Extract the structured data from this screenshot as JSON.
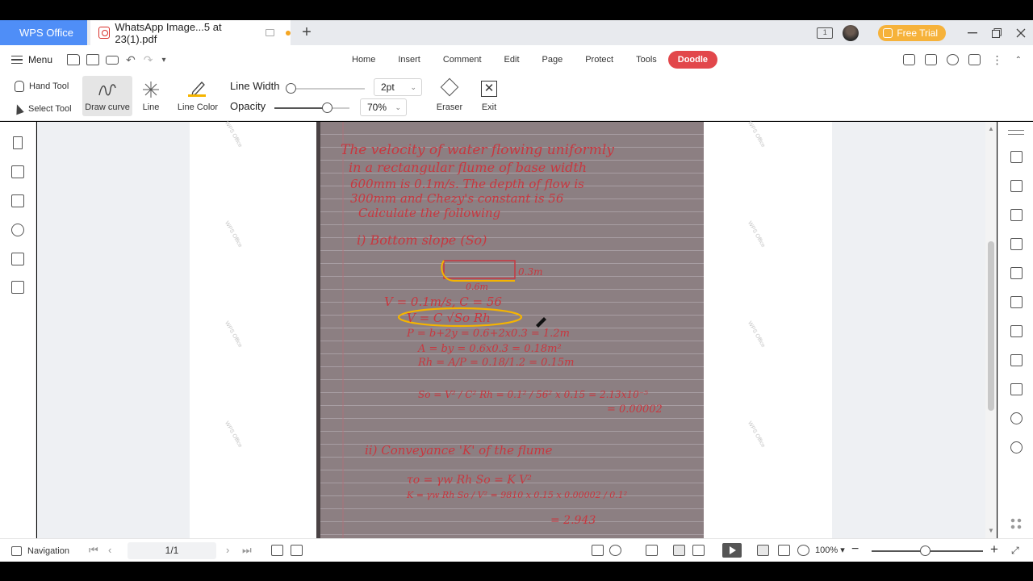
{
  "tabs": {
    "app_label": "WPS Office",
    "doc_label": "WhatsApp Image...5 at 23(1).pdf",
    "add_label": "+"
  },
  "window": {
    "free_trial_label": "Free Trial",
    "page_count_badge": "1"
  },
  "menubar": {
    "menu_label": "Menu",
    "tabs": [
      "Home",
      "Insert",
      "Comment",
      "Edit",
      "Page",
      "Protect",
      "Tools",
      "Doodle"
    ],
    "active_tab": "Doodle"
  },
  "toolbar": {
    "hand_tool": "Hand Tool",
    "select_tool": "Select Tool",
    "draw_curve": "Draw curve",
    "line": "Line",
    "line_color": "Line Color",
    "line_color_value": "#f5b400",
    "line_width_label": "Line Width",
    "line_width_value": "2pt",
    "line_width_level": 0.0,
    "opacity_label": "Opacity",
    "opacity_value": "70%",
    "opacity_level": 0.7,
    "eraser": "Eraser",
    "exit": "Exit"
  },
  "document": {
    "watermark": "WPS Office",
    "handwriting": [
      "The velocity of water flowing uniformly",
      "in a rectangular flume of base width",
      "600mm is 0.1m/s. The depth of flow is",
      "300mm and Chezy's constant is 56",
      "Calculate the following",
      "i) Bottom slope (So)",
      "0.3m",
      "0.6m",
      "V = 0.1m/s, C = 56",
      "V = C √So Rh",
      "P = b+2y = 0.6+2x0.3 = 1.2m",
      "A = by = 0.6x0.3 = 0.18m²",
      "Rh = A/P = 0.18/1.2 = 0.15m",
      "So = V² / C² Rh = 0.1² / 56² x 0.15 = 2.13x10⁻⁵",
      "= 0.00002",
      "ii) Conveyance 'K' of the flume",
      "τo = γw Rh So = K V²",
      "K = γw Rh So / V² = 9810 x 0.15 x 0.00002 / 0.1²",
      "= 2.943"
    ]
  },
  "statusbar": {
    "navigation": "Navigation",
    "page_indicator": "1/1",
    "zoom": "100%",
    "zoom_level": 1.0
  },
  "colors": {
    "accent": "#4f8ef7",
    "doodle_tab": "#e2474b",
    "trial": "#f6b23a",
    "ink": "#c8373f",
    "highlight": "#f5b400"
  }
}
